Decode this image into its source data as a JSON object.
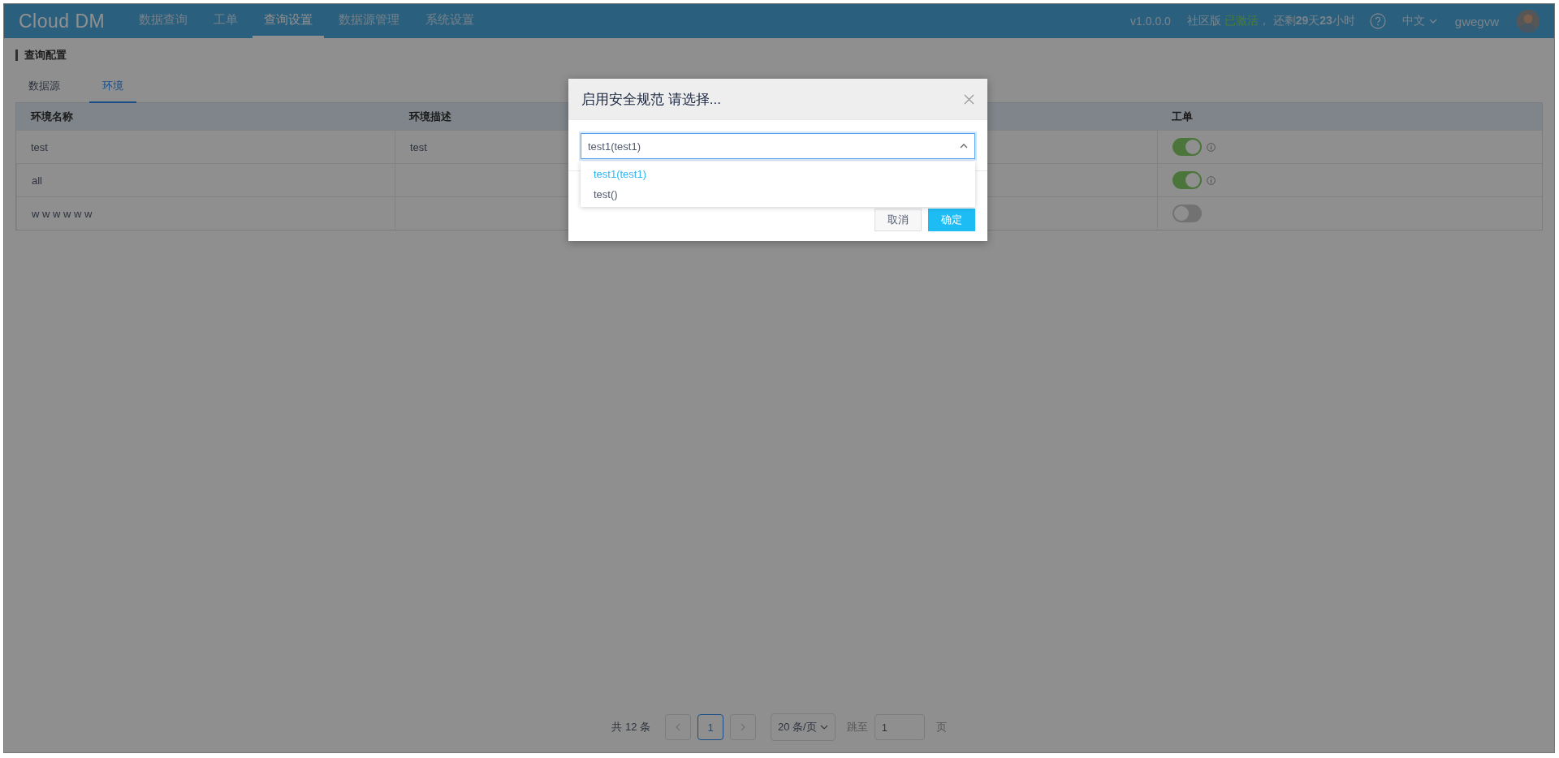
{
  "topbar": {
    "logo": "Cloud DM",
    "nav": [
      {
        "label": "数据查询",
        "selected": false
      },
      {
        "label": "工单",
        "selected": false
      },
      {
        "label": "查询设置",
        "selected": true
      },
      {
        "label": "数据源管理",
        "selected": false
      },
      {
        "label": "系统设置",
        "selected": false
      }
    ],
    "version": "v1.0.0.0",
    "edition": "社区版",
    "activation": "已激活",
    "remaining": "， 还剩**29**天**23**小时",
    "language": "中文",
    "user": "gwegvw"
  },
  "page": {
    "title": "查询配置",
    "tabs": [
      {
        "label": "数据源",
        "selected": false
      },
      {
        "label": "环境",
        "selected": true
      }
    ],
    "table": {
      "columns": [
        "环境名称",
        "环境描述",
        "工单"
      ],
      "rows": [
        {
          "name": "test",
          "description": "test",
          "workorder_on": true,
          "info": true
        },
        {
          "name": "all",
          "description": "",
          "workorder_on": true,
          "info": true
        },
        {
          "name": "w w w w w w",
          "description": "",
          "workorder_on": false,
          "info": false
        }
      ]
    },
    "pagination": {
      "total": "共 12 条",
      "pages": [
        {
          "label": "1",
          "selected": true
        }
      ],
      "page_size": "20 条/页",
      "jump_label": "跳至",
      "jump_value": "1",
      "page_suffix": "页"
    }
  },
  "dialog": {
    "title": "启用安全规范 请选择...",
    "select": {
      "value": "test1(test1)",
      "expanded": true,
      "options": [
        {
          "label": "test1(test1)",
          "selected": true
        },
        {
          "label": "test()",
          "selected": false
        }
      ]
    },
    "buttons": [
      {
        "label": "取消",
        "kind": "default"
      },
      {
        "label": "确定",
        "kind": "primary"
      }
    ]
  }
}
